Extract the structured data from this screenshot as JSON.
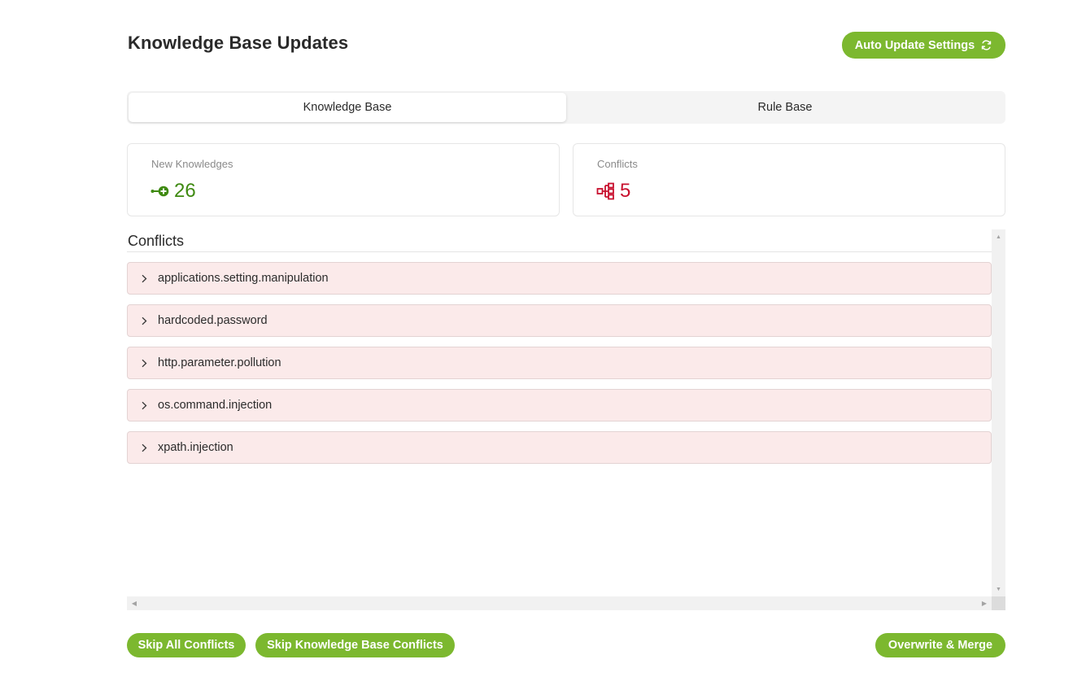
{
  "header": {
    "title": "Knowledge Base Updates",
    "auto_update_label": "Auto Update Settings",
    "auto_update_icon": "refresh-icon"
  },
  "tabs": [
    {
      "label": "Knowledge Base",
      "active": true
    },
    {
      "label": "Rule Base",
      "active": false
    }
  ],
  "stats": {
    "new_knowledges": {
      "label": "New Knowledges",
      "value": "26",
      "icon": "key-plus-icon",
      "color": "#3f8a12"
    },
    "conflicts": {
      "label": "Conflicts",
      "value": "5",
      "icon": "hierarchy-icon",
      "color": "#c8102e"
    }
  },
  "conflicts_section": {
    "title": "Conflicts",
    "items": [
      {
        "label": "applications.setting.manipulation"
      },
      {
        "label": "hardcoded.password"
      },
      {
        "label": "http.parameter.pollution"
      },
      {
        "label": "os.command.injection"
      },
      {
        "label": "xpath.injection"
      }
    ]
  },
  "actions": {
    "skip_all": "Skip All Conflicts",
    "skip_kb": "Skip Knowledge Base Conflicts",
    "overwrite_merge": "Overwrite & Merge"
  },
  "colors": {
    "accent": "#7cb82f",
    "conflict_row_bg": "#fbeaea"
  }
}
